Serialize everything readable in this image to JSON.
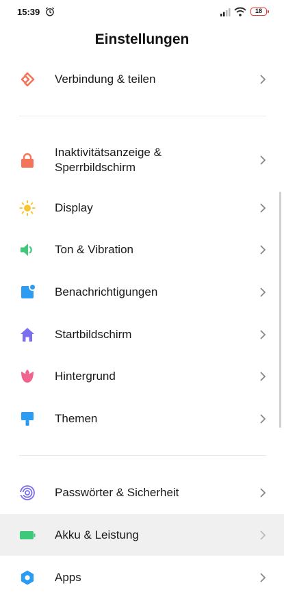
{
  "status_bar": {
    "time": "15:39",
    "battery": "18",
    "battery_color": "#e53935"
  },
  "header": {
    "title": "Einstellungen"
  },
  "items": [
    {
      "label": "Verbindung & teilen",
      "icon": "share-icon",
      "color": "#f4735b"
    },
    {
      "label": "Inaktivitätsanzeige &",
      "label2": "Sperrbildschirm",
      "icon": "lock-icon",
      "color": "#f4735b"
    },
    {
      "label": "Display",
      "icon": "sun-icon",
      "color": "#f7c531"
    },
    {
      "label": "Ton & Vibration",
      "icon": "speaker-icon",
      "color": "#3ec97a"
    },
    {
      "label": "Benachrichtigungen",
      "icon": "notification-icon",
      "color": "#2b9cf2"
    },
    {
      "label": "Startbildschirm",
      "icon": "home-icon",
      "color": "#7b6ff0"
    },
    {
      "label": "Hintergrund",
      "icon": "tulip-icon",
      "color": "#f06490"
    },
    {
      "label": "Themen",
      "icon": "brush-icon",
      "color": "#2b9cf2"
    },
    {
      "label": "Passwörter & Sicherheit",
      "icon": "fingerprint-icon",
      "color": "#7b6ff0"
    },
    {
      "label": "Akku & Leistung",
      "icon": "battery-icon",
      "color": "#3ec97a"
    },
    {
      "label": "Apps",
      "icon": "gear-icon",
      "color": "#2b9cf2"
    }
  ]
}
